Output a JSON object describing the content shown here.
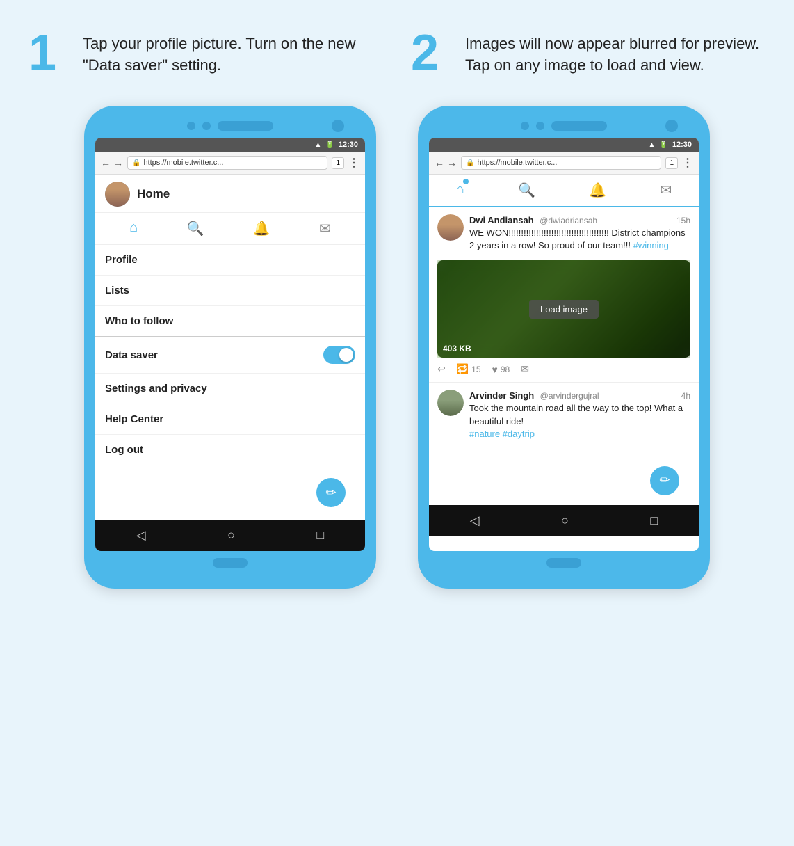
{
  "steps": [
    {
      "number": "1",
      "text": "Tap your profile picture. Turn on the new \"Data saver\" setting."
    },
    {
      "number": "2",
      "text": "Images will now appear blurred for preview. Tap on any image to load and view."
    }
  ],
  "phone1": {
    "status_bar": {
      "time": "12:30"
    },
    "browser": {
      "url": "https://mobile.twitter.c...",
      "tab_number": "1"
    },
    "home_title": "Home",
    "menu_items": [
      {
        "label": "Profile"
      },
      {
        "label": "Lists"
      },
      {
        "label": "Who to follow"
      }
    ],
    "data_saver_label": "Data saver",
    "settings_label": "Settings and privacy",
    "help_label": "Help Center",
    "logout_label": "Log out"
  },
  "phone2": {
    "status_bar": {
      "time": "12:30"
    },
    "browser": {
      "url": "https://mobile.twitter.c...",
      "tab_number": "1"
    },
    "tweets": [
      {
        "name": "Dwi Andiansah",
        "handle": "@dwiadriansah",
        "time": "15h",
        "text": "WE WON!!!!!!!!!!!!!!!!!!!!!!!!!!!!!!!!!!!!!!!! District champions 2 years in a row! So proud of our team!!!",
        "hashtag": "#winning",
        "has_image": true,
        "image_size": "403 KB",
        "load_image_label": "Load image",
        "retweets": "15",
        "likes": "98"
      },
      {
        "name": "Arvinder Singh",
        "handle": "@arvindergujral",
        "time": "4h",
        "text": "Took the mountain road all the way to the top! What a beautiful ride!",
        "hashtags": "#nature #daytrip",
        "has_image": false
      }
    ]
  },
  "icons": {
    "home": "🏠",
    "search": "🔍",
    "bell": "🔔",
    "mail": "✉",
    "back": "◁",
    "forward": "▷",
    "circle": "○",
    "square": "□",
    "compose": "✏",
    "retweet": "↩",
    "heart": "♥",
    "reply": "↩"
  }
}
